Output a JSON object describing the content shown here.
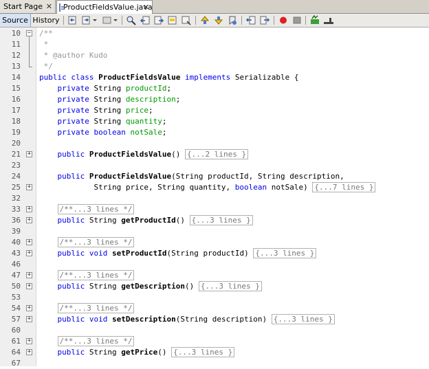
{
  "tabs": [
    {
      "label": "Start Page",
      "active": false
    },
    {
      "label": "ProductFieldsValue.java",
      "active": true
    }
  ],
  "toolbar": {
    "source_label": "Source",
    "history_label": "History"
  },
  "lines": [
    {
      "n": "10",
      "fold": "open",
      "tokens": [
        [
          "cm",
          "/**"
        ]
      ]
    },
    {
      "n": "11",
      "tokens": [
        [
          "cm",
          " *"
        ]
      ]
    },
    {
      "n": "12",
      "tokens": [
        [
          "cm",
          " * @author Kudo"
        ]
      ]
    },
    {
      "n": "13",
      "tokens": [
        [
          "cm",
          " */"
        ]
      ]
    },
    {
      "n": "14",
      "tokens": [
        [
          "kw",
          "public"
        ],
        [
          "",
          " "
        ],
        [
          "kw",
          "class"
        ],
        [
          "",
          " "
        ],
        [
          "b",
          "ProductFieldsValue"
        ],
        [
          "",
          " "
        ],
        [
          "kw",
          "implements"
        ],
        [
          "",
          " Serializable {"
        ]
      ]
    },
    {
      "n": "15",
      "tokens": [
        [
          "",
          "    "
        ],
        [
          "kw",
          "private"
        ],
        [
          "",
          " String "
        ],
        [
          "fld",
          "productId"
        ],
        [
          "",
          ";"
        ]
      ]
    },
    {
      "n": "16",
      "tokens": [
        [
          "",
          "    "
        ],
        [
          "kw",
          "private"
        ],
        [
          "",
          " String "
        ],
        [
          "fld",
          "description"
        ],
        [
          "",
          ";"
        ]
      ]
    },
    {
      "n": "17",
      "tokens": [
        [
          "",
          "    "
        ],
        [
          "kw",
          "private"
        ],
        [
          "",
          " String "
        ],
        [
          "fld",
          "price"
        ],
        [
          "",
          ";"
        ]
      ]
    },
    {
      "n": "18",
      "tokens": [
        [
          "",
          "    "
        ],
        [
          "kw",
          "private"
        ],
        [
          "",
          " String "
        ],
        [
          "fld",
          "quantity"
        ],
        [
          "",
          ";"
        ]
      ]
    },
    {
      "n": "19",
      "tokens": [
        [
          "",
          "    "
        ],
        [
          "kw",
          "private"
        ],
        [
          "",
          " "
        ],
        [
          "kw",
          "boolean"
        ],
        [
          "",
          " "
        ],
        [
          "fld",
          "notSale"
        ],
        [
          "",
          ";"
        ]
      ]
    },
    {
      "n": "20",
      "tokens": []
    },
    {
      "n": "21",
      "fold": "closed",
      "tokens": [
        [
          "",
          "    "
        ],
        [
          "kw",
          "public"
        ],
        [
          "",
          " "
        ],
        [
          "b",
          "ProductFieldsValue"
        ],
        [
          "",
          "() "
        ],
        [
          "box",
          "{...2 lines }"
        ]
      ]
    },
    {
      "n": "23",
      "tokens": []
    },
    {
      "n": "24",
      "tokens": [
        [
          "",
          "    "
        ],
        [
          "kw",
          "public"
        ],
        [
          "",
          " "
        ],
        [
          "b",
          "ProductFieldsValue"
        ],
        [
          "",
          "(String productId, String description,"
        ]
      ]
    },
    {
      "n": "25",
      "fold": "closed",
      "tokens": [
        [
          "",
          "            String price, String quantity, "
        ],
        [
          "kw",
          "boolean"
        ],
        [
          "",
          " notSale) "
        ],
        [
          "box",
          "{...7 lines }"
        ]
      ]
    },
    {
      "n": "32",
      "tokens": []
    },
    {
      "n": "33",
      "fold": "closed",
      "tokens": [
        [
          "",
          "    "
        ],
        [
          "box",
          "/**...3 lines */"
        ]
      ]
    },
    {
      "n": "36",
      "fold": "closed",
      "tokens": [
        [
          "",
          "    "
        ],
        [
          "kw",
          "public"
        ],
        [
          "",
          " String "
        ],
        [
          "b",
          "getProductId"
        ],
        [
          "",
          "() "
        ],
        [
          "box",
          "{...3 lines }"
        ]
      ]
    },
    {
      "n": "39",
      "tokens": []
    },
    {
      "n": "40",
      "fold": "closed",
      "tokens": [
        [
          "",
          "    "
        ],
        [
          "box",
          "/**...3 lines */"
        ]
      ]
    },
    {
      "n": "43",
      "fold": "closed",
      "tokens": [
        [
          "",
          "    "
        ],
        [
          "kw",
          "public"
        ],
        [
          "",
          " "
        ],
        [
          "kw",
          "void"
        ],
        [
          "",
          " "
        ],
        [
          "b",
          "setProductId"
        ],
        [
          "",
          "(String productId) "
        ],
        [
          "box",
          "{...3 lines }"
        ]
      ]
    },
    {
      "n": "46",
      "tokens": []
    },
    {
      "n": "47",
      "fold": "closed",
      "tokens": [
        [
          "",
          "    "
        ],
        [
          "box",
          "/**...3 lines */"
        ]
      ]
    },
    {
      "n": "50",
      "fold": "closed",
      "tokens": [
        [
          "",
          "    "
        ],
        [
          "kw",
          "public"
        ],
        [
          "",
          " String "
        ],
        [
          "b",
          "getDescription"
        ],
        [
          "",
          "() "
        ],
        [
          "box",
          "{...3 lines }"
        ]
      ]
    },
    {
      "n": "53",
      "tokens": []
    },
    {
      "n": "54",
      "fold": "closed",
      "tokens": [
        [
          "",
          "    "
        ],
        [
          "box",
          "/**...3 lines */"
        ]
      ]
    },
    {
      "n": "57",
      "fold": "closed",
      "tokens": [
        [
          "",
          "    "
        ],
        [
          "kw",
          "public"
        ],
        [
          "",
          " "
        ],
        [
          "kw",
          "void"
        ],
        [
          "",
          " "
        ],
        [
          "b",
          "setDescription"
        ],
        [
          "",
          "(String description) "
        ],
        [
          "box",
          "{...3 lines }"
        ]
      ]
    },
    {
      "n": "60",
      "tokens": []
    },
    {
      "n": "61",
      "fold": "closed",
      "tokens": [
        [
          "",
          "    "
        ],
        [
          "box",
          "/**...3 lines */"
        ]
      ]
    },
    {
      "n": "64",
      "fold": "closed",
      "tokens": [
        [
          "",
          "    "
        ],
        [
          "kw",
          "public"
        ],
        [
          "",
          " String "
        ],
        [
          "b",
          "getPrice"
        ],
        [
          "",
          "() "
        ],
        [
          "box",
          "{...3 lines }"
        ]
      ]
    },
    {
      "n": "67",
      "tokens": []
    }
  ]
}
